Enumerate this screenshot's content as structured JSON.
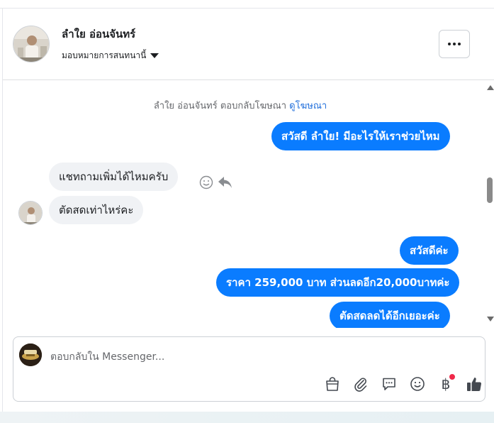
{
  "header": {
    "contact_name": "ลำใย อ่อนจันทร์",
    "assign_label": "มอบหมายการสนทนานี้"
  },
  "messages": {
    "system_note": "ลำใย อ่อนจันทร์ ตอบกลับโฆษณา",
    "system_link": "ดูโฆษณา",
    "out_1": "สวัสดี ลำใย! มีอะไรให้เราช่วยไหม",
    "in_1": "แชทถามเพิ่มได้ไหมครับ",
    "in_2": "ตัดสดเท่าไหร่คะ",
    "out_2": "สวัสดีค่ะ",
    "out_3": "ราคา 259,000 บาท ส่วนลดอีก20,000บาทค่ะ",
    "out_4": "ตัดสดลดได้อีกเยอะค่ะ"
  },
  "composer": {
    "placeholder": "ตอบกลับใน Messenger...",
    "baht_symbol": "฿"
  },
  "colors": {
    "outgoing_bubble": "#0a7cff",
    "incoming_bubble": "#f0f2f5",
    "link": "#216fdb",
    "badge": "#f02849"
  },
  "icons": [
    "more-icon",
    "smile-icon",
    "reply-icon",
    "bag-icon",
    "paperclip-icon",
    "saved-reply-icon",
    "emoji-icon",
    "baht-icon",
    "thumbs-up-icon"
  ]
}
